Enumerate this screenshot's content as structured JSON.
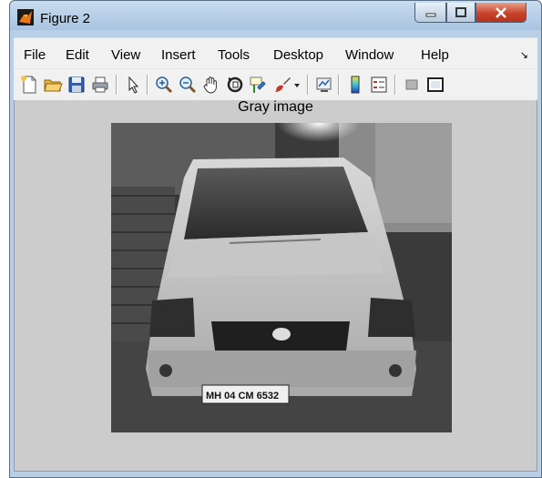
{
  "window": {
    "title": "Figure 2",
    "controls": {
      "minimize": "minimize-icon",
      "maximize": "maximize-icon",
      "close": "close-icon"
    }
  },
  "menu": {
    "items": [
      "File",
      "Edit",
      "View",
      "Insert",
      "Tools",
      "Desktop",
      "Window",
      "Help"
    ],
    "dock_icon": "dock-arrow-icon"
  },
  "toolbar": {
    "tools": [
      "new-figure-icon",
      "open-file-icon",
      "save-icon",
      "print-icon",
      "edit-plot-arrow-icon",
      "zoom-in-icon",
      "zoom-out-icon",
      "pan-hand-icon",
      "rotate-3d-icon",
      "data-cursor-icon",
      "brush-icon",
      "brush-dropdown-icon",
      "link-plot-icon",
      "colorbar-icon",
      "legend-icon",
      "hide-plot-tools-icon",
      "show-plot-tools-icon"
    ]
  },
  "axes": {
    "title": "Gray image"
  },
  "image": {
    "content": "grayscale photo of a car front",
    "plate_text": "MH 04 CM 6532"
  },
  "colors": {
    "titlebar": "#b9cfe6",
    "close_button": "#c8432a",
    "menu_background": "#f1f1f1",
    "figure_background": "#cccccc"
  }
}
